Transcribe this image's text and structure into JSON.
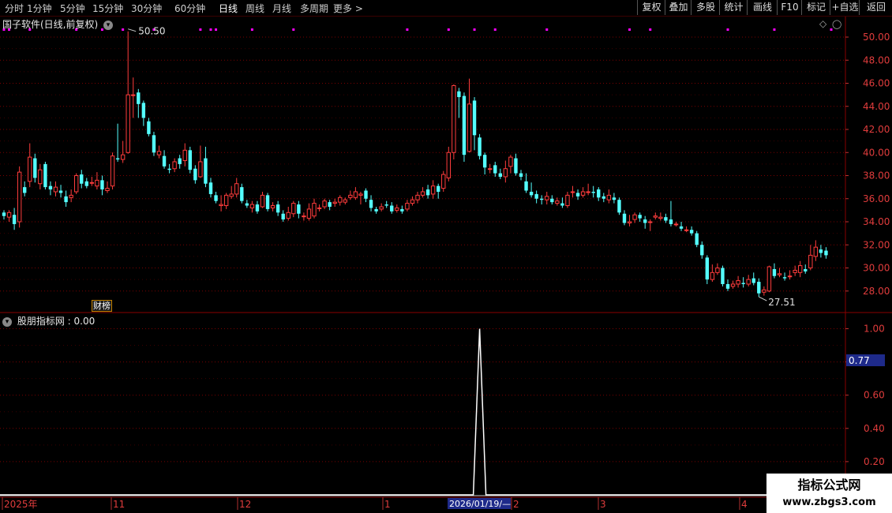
{
  "toolbar": {
    "tabs": [
      "分时",
      "1分钟",
      "5分钟",
      "15分钟",
      "30分钟",
      "60分钟",
      "日线",
      "周线",
      "月线",
      "多周期",
      "更多 >"
    ],
    "active": "日线",
    "right_buttons": [
      "复权",
      "叠加",
      "多股",
      "统计",
      "画线",
      "F10",
      "标记",
      "+自选",
      "返回"
    ]
  },
  "main_panel": {
    "title": "国子软件(日线,前复权)",
    "high_label": "50.50",
    "low_label": "27.51",
    "badge": "财榜",
    "price_axis": [
      "50.00",
      "48.00",
      "46.00",
      "44.00",
      "42.00",
      "40.00",
      "38.00",
      "36.00",
      "34.00",
      "32.00",
      "30.00",
      "28.00"
    ]
  },
  "indicator_panel": {
    "title": "股朋指标网 : 0.00",
    "axis": [
      "1.00",
      "0.80",
      "0.60",
      "0.40",
      "0.20"
    ],
    "cursor_value": "0.77"
  },
  "time_axis": {
    "labels": [
      "2025年",
      "11",
      "12",
      "1",
      "2",
      "3",
      "4"
    ],
    "cursor_date": "2026/01/19/—"
  },
  "colors": {
    "up": "#ff3c3c",
    "down": "#54ffff",
    "grid": "#7a0000",
    "axis_text": "#e03c3c",
    "magenta": "#ff00ff"
  },
  "watermark": {
    "line1": "指标公式网",
    "line2": "www.zbgs3.com"
  },
  "chart_data": {
    "type": "candlestick",
    "ylim": [
      27,
      51
    ],
    "indicator_ylim": [
      0,
      1.1
    ],
    "candles": [
      [
        34.8,
        34.5,
        35.0,
        34.2
      ],
      [
        34.4,
        34.8,
        35.0,
        34.0
      ],
      [
        34.6,
        33.8,
        35.2,
        33.3
      ],
      [
        34.0,
        38.3,
        38.8,
        33.5
      ],
      [
        37.0,
        36.5,
        37.5,
        36.2
      ],
      [
        37.5,
        39.6,
        40.8,
        37.0
      ],
      [
        39.5,
        37.8,
        39.9,
        37.4
      ],
      [
        37.3,
        38.5,
        39.0,
        36.8
      ],
      [
        39.0,
        37.0,
        39.2,
        36.8
      ],
      [
        37.1,
        36.8,
        37.5,
        36.3
      ],
      [
        36.6,
        37.0,
        37.5,
        36.2
      ],
      [
        36.7,
        36.5,
        37.2,
        36.1
      ],
      [
        36.2,
        35.7,
        36.7,
        35.3
      ],
      [
        36.1,
        36.3,
        36.8,
        35.7
      ],
      [
        36.6,
        38.0,
        38.2,
        36.4
      ],
      [
        38.1,
        37.3,
        38.5,
        36.9
      ],
      [
        37.5,
        37.1,
        37.8,
        36.9
      ],
      [
        37.4,
        37.4,
        37.9,
        37.1
      ],
      [
        37.1,
        37.6,
        38.3,
        36.8
      ],
      [
        37.6,
        36.8,
        38.0,
        36.3
      ],
      [
        36.7,
        36.9,
        37.5,
        36.5
      ],
      [
        37.1,
        39.7,
        40.0,
        36.8
      ],
      [
        39.5,
        39.4,
        42.5,
        39.2
      ],
      [
        39.4,
        39.8,
        41.0,
        39.1
      ],
      [
        40.0,
        45.0,
        50.5,
        39.9
      ],
      [
        45.0,
        45.0,
        46.5,
        43.0
      ],
      [
        45.2,
        44.2,
        45.5,
        43.0
      ],
      [
        44.3,
        43.0,
        44.5,
        42.3
      ],
      [
        42.7,
        41.6,
        43.0,
        41.4
      ],
      [
        41.5,
        40.0,
        41.8,
        39.7
      ],
      [
        39.8,
        40.1,
        40.6,
        39.5
      ],
      [
        39.7,
        38.8,
        40.2,
        38.6
      ],
      [
        38.6,
        38.5,
        39.0,
        38.2
      ],
      [
        38.6,
        39.2,
        39.5,
        38.3
      ],
      [
        39.5,
        39.0,
        39.8,
        38.6
      ],
      [
        39.3,
        40.2,
        40.8,
        38.8
      ],
      [
        40.2,
        38.5,
        40.5,
        38.2
      ],
      [
        38.6,
        37.6,
        38.9,
        37.3
      ],
      [
        37.9,
        39.2,
        40.6,
        37.8
      ],
      [
        39.5,
        37.3,
        40.5,
        37.0
      ],
      [
        37.4,
        36.4,
        37.8,
        36.1
      ],
      [
        36.3,
        35.8,
        36.6,
        35.6
      ],
      [
        35.4,
        35.5,
        36.3,
        34.9
      ],
      [
        35.4,
        36.3,
        36.5,
        35.1
      ],
      [
        36.2,
        36.4,
        37.1,
        36.0
      ],
      [
        36.4,
        37.3,
        37.8,
        36.1
      ],
      [
        37.0,
        35.8,
        37.3,
        35.6
      ],
      [
        35.6,
        35.4,
        35.9,
        35.2
      ],
      [
        35.2,
        35.5,
        35.8,
        34.8
      ],
      [
        35.5,
        34.9,
        35.8,
        34.7
      ],
      [
        35.3,
        36.3,
        36.6,
        35.2
      ],
      [
        36.3,
        35.1,
        36.5,
        34.9
      ],
      [
        35.2,
        35.4,
        35.7,
        34.9
      ],
      [
        35.5,
        34.8,
        35.8,
        34.5
      ],
      [
        34.7,
        34.2,
        35.0,
        34.0
      ],
      [
        34.3,
        34.8,
        35.3,
        34.1
      ],
      [
        34.7,
        35.6,
        35.8,
        34.4
      ],
      [
        35.5,
        34.7,
        35.8,
        34.3
      ],
      [
        34.5,
        34.5,
        34.8,
        34.1
      ],
      [
        34.3,
        35.1,
        35.6,
        34.1
      ],
      [
        34.5,
        35.6,
        36.0,
        34.3
      ],
      [
        35.2,
        35.2,
        35.5,
        34.9
      ],
      [
        35.3,
        35.8,
        36.0,
        35.1
      ],
      [
        35.7,
        35.3,
        35.9,
        35.0
      ],
      [
        35.6,
        35.7,
        36.0,
        35.3
      ],
      [
        35.7,
        36.1,
        36.3,
        35.4
      ],
      [
        35.7,
        35.9,
        36.1,
        35.5
      ],
      [
        36.1,
        36.3,
        36.7,
        35.9
      ],
      [
        36.1,
        36.6,
        37.0,
        35.9
      ],
      [
        36.3,
        36.4,
        36.6,
        35.5
      ],
      [
        36.7,
        36.0,
        36.9,
        35.7
      ],
      [
        35.9,
        35.2,
        36.3,
        34.9
      ],
      [
        35.1,
        34.9,
        35.3,
        34.7
      ],
      [
        35.1,
        35.3,
        35.6,
        34.9
      ],
      [
        35.5,
        35.4,
        35.8,
        35.2
      ],
      [
        35.4,
        34.9,
        35.7,
        34.7
      ],
      [
        35.0,
        35.2,
        35.5,
        34.8
      ],
      [
        35.1,
        34.9,
        35.4,
        34.7
      ],
      [
        35.1,
        35.6,
        35.9,
        34.9
      ],
      [
        35.6,
        35.9,
        36.2,
        35.4
      ],
      [
        35.9,
        36.3,
        36.6,
        35.6
      ],
      [
        36.3,
        36.6,
        37.0,
        36.1
      ],
      [
        36.8,
        36.3,
        37.2,
        36.0
      ],
      [
        36.4,
        37.1,
        37.6,
        36.0
      ],
      [
        37.1,
        36.6,
        37.3,
        36.0
      ],
      [
        36.9,
        38.1,
        38.4,
        36.6
      ],
      [
        37.8,
        40.0,
        40.5,
        37.5
      ],
      [
        40.0,
        45.8,
        45.9,
        39.4
      ],
      [
        45.3,
        44.8,
        45.6,
        43.0
      ],
      [
        44.9,
        39.8,
        45.2,
        39.2
      ],
      [
        40.1,
        44.2,
        46.4,
        40.0
      ],
      [
        44.5,
        41.5,
        44.8,
        40.2
      ],
      [
        41.3,
        39.7,
        41.6,
        39.4
      ],
      [
        39.8,
        38.7,
        40.0,
        38.1
      ],
      [
        38.6,
        38.6,
        39.0,
        38.2
      ],
      [
        38.9,
        38.2,
        39.2,
        37.9
      ],
      [
        38.2,
        37.9,
        38.6,
        37.7
      ],
      [
        37.9,
        38.6,
        39.3,
        37.4
      ],
      [
        38.8,
        39.6,
        39.8,
        38.2
      ],
      [
        39.5,
        38.2,
        39.9,
        38.0
      ],
      [
        38.2,
        37.9,
        38.5,
        37.6
      ],
      [
        37.5,
        36.7,
        38.2,
        36.5
      ],
      [
        36.6,
        36.3,
        37.4,
        36.1
      ],
      [
        36.4,
        36.0,
        36.7,
        35.6
      ],
      [
        36.0,
        35.9,
        36.3,
        35.5
      ],
      [
        35.9,
        36.2,
        36.6,
        35.5
      ],
      [
        36.0,
        35.7,
        36.3,
        35.5
      ],
      [
        35.6,
        35.8,
        36.1,
        35.4
      ],
      [
        35.6,
        35.4,
        36.1,
        35.2
      ],
      [
        35.4,
        36.3,
        36.6,
        35.2
      ],
      [
        36.6,
        36.6,
        37.1,
        36.1
      ],
      [
        36.5,
        36.2,
        36.8,
        35.9
      ],
      [
        36.3,
        36.6,
        37.0,
        36.1
      ],
      [
        36.6,
        36.6,
        37.3,
        36.3
      ],
      [
        36.6,
        36.5,
        37.1,
        36.1
      ],
      [
        36.8,
        36.1,
        37.0,
        35.8
      ],
      [
        36.2,
        36.0,
        36.5,
        35.7
      ],
      [
        35.9,
        36.3,
        36.8,
        35.6
      ],
      [
        36.1,
        35.9,
        36.5,
        35.6
      ],
      [
        35.9,
        34.8,
        36.1,
        34.6
      ],
      [
        34.7,
        33.9,
        35.0,
        33.7
      ],
      [
        33.9,
        34.0,
        34.6,
        33.6
      ],
      [
        34.2,
        34.6,
        34.8,
        33.9
      ],
      [
        34.6,
        34.3,
        34.8,
        34.0
      ],
      [
        34.2,
        33.9,
        34.5,
        33.4
      ],
      [
        34.0,
        34.0,
        34.2,
        33.2
      ],
      [
        34.4,
        34.5,
        34.8,
        34.2
      ],
      [
        34.3,
        34.4,
        34.8,
        34.1
      ],
      [
        34.4,
        34.1,
        34.7,
        33.9
      ],
      [
        34.2,
        33.8,
        35.8,
        33.6
      ],
      [
        33.8,
        33.8,
        34.0,
        33.6
      ],
      [
        33.6,
        33.4,
        34.0,
        33.2
      ],
      [
        33.3,
        33.3,
        33.6,
        33.1
      ],
      [
        33.3,
        33.0,
        33.6,
        32.8
      ],
      [
        33.0,
        32.0,
        33.2,
        31.8
      ],
      [
        32.0,
        31.1,
        32.3,
        30.8
      ],
      [
        30.9,
        29.0,
        31.1,
        28.6
      ],
      [
        29.0,
        29.6,
        30.3,
        28.8
      ],
      [
        29.6,
        30.0,
        30.4,
        29.4
      ],
      [
        30.0,
        28.6,
        30.2,
        28.4
      ],
      [
        28.6,
        28.2,
        29.0,
        28.0
      ],
      [
        28.4,
        28.6,
        28.9,
        28.2
      ],
      [
        28.6,
        28.9,
        29.3,
        28.3
      ],
      [
        28.7,
        28.6,
        29.2,
        28.3
      ],
      [
        28.6,
        29.0,
        29.4,
        28.4
      ],
      [
        29.1,
        28.7,
        29.6,
        28.5
      ],
      [
        28.8,
        27.8,
        29.1,
        27.5
      ],
      [
        27.9,
        28.1,
        28.4,
        27.6
      ],
      [
        28.0,
        30.1,
        30.2,
        27.9
      ],
      [
        29.9,
        29.3,
        30.4,
        29.1
      ],
      [
        29.4,
        29.5,
        30.0,
        29.2
      ],
      [
        29.2,
        29.1,
        29.6,
        28.9
      ],
      [
        29.3,
        29.3,
        29.8,
        29.0
      ],
      [
        29.6,
        29.8,
        30.2,
        29.3
      ],
      [
        29.6,
        30.2,
        30.6,
        29.2
      ],
      [
        29.9,
        29.7,
        30.3,
        29.5
      ],
      [
        30.0,
        31.1,
        32.0,
        29.8
      ],
      [
        31.0,
        31.8,
        32.4,
        30.6
      ],
      [
        31.6,
        31.3,
        32.0,
        30.9
      ],
      [
        31.5,
        31.1,
        31.8,
        30.8
      ]
    ],
    "signal_peak_index": 92,
    "signal_peak_value": 1.0
  }
}
